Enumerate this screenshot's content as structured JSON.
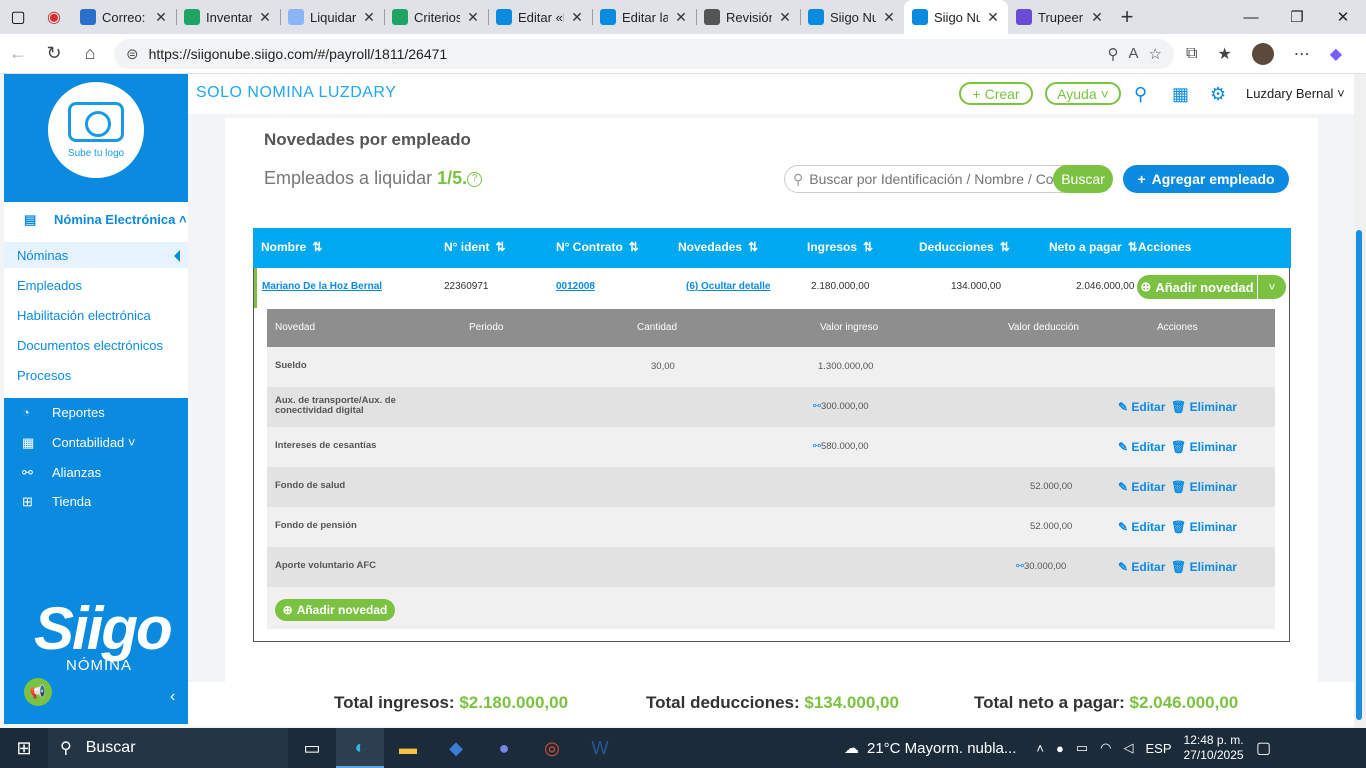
{
  "browser": {
    "tabs": [
      {
        "title": "Correo: l",
        "color": "#2a6fc9"
      },
      {
        "title": "Inventar",
        "color": "#21a366"
      },
      {
        "title": "Liquidar",
        "color": "#8ab4f8"
      },
      {
        "title": "Criterios",
        "color": "#21a366"
      },
      {
        "title": "Editar «L",
        "color": "#0b8be0"
      },
      {
        "title": "Editar la",
        "color": "#0b8be0"
      },
      {
        "title": "Revisión",
        "color": "#555555"
      },
      {
        "title": "Siigo Nu",
        "color": "#0b8be0"
      },
      {
        "title": "Siigo Nu",
        "color": "#0b8be0"
      },
      {
        "title": "Trupeer",
        "color": "#6b4bd6"
      }
    ],
    "url": "https://siigonube.siigo.com/#/payroll/1811/26471"
  },
  "sidebar": {
    "logo_label": "Sube tu logo",
    "section_title": "Nómina Electrónica",
    "items": [
      "Nóminas",
      "Empleados",
      "Habilitación electrónica",
      "Documentos electrónicos",
      "Procesos"
    ],
    "blue_items": [
      "Reportes",
      "Contabilidad",
      "Alianzas",
      "Tienda"
    ],
    "brand": "Siigo",
    "brand_sub": "NÓMINA"
  },
  "topbar": {
    "company": "SOLO NOMINA LUZDARY",
    "create": "Crear",
    "help": "Ayuda",
    "user": "Luzdary Bernal"
  },
  "page": {
    "title": "Novedades por empleado",
    "emp_label": "Empleados a liquidar",
    "emp_count": "1/5.",
    "search_placeholder": "Buscar por Identificación / Nombre / Cor",
    "search_btn": "Buscar",
    "add_emp_btn": "Agregar empleado"
  },
  "table": {
    "headers": [
      "Nombre",
      "N° ident",
      "N° Contrato",
      "Novedades",
      "Ingresos",
      "Deducciones",
      "Neto a pagar",
      "Acciones"
    ],
    "row": {
      "name": "Mariano De la Hoz Bernal",
      "ident": "22360971",
      "contract": "0012008",
      "novedades": "(6) Ocultar detalle",
      "ingresos": "2.180.000,00",
      "deducciones": "134.000,00",
      "neto": "2.046.000,00",
      "add_btn": "Añadir novedad"
    }
  },
  "detail": {
    "headers": [
      "Novedad",
      "Periodo",
      "Cantidad",
      "Valor ingreso",
      "Valor deducción",
      "Acciones"
    ],
    "rows": [
      {
        "novedad": "Sueldo",
        "cantidad": "30,00",
        "ingreso": "1.300.000,00",
        "deduccion": "",
        "link": false
      },
      {
        "novedad": "Aux. de transporte/Aux. de conectividad digital",
        "cantidad": "",
        "ingreso": "300.000,00",
        "deduccion": "",
        "link": true
      },
      {
        "novedad": "Intereses de cesantías",
        "cantidad": "",
        "ingreso": "580.000,00",
        "deduccion": "",
        "link": true
      },
      {
        "novedad": "Fondo de salud",
        "cantidad": "",
        "ingreso": "",
        "deduccion": "52.000,00",
        "link": false
      },
      {
        "novedad": "Fondo de pensión",
        "cantidad": "",
        "ingreso": "",
        "deduccion": "52.000,00",
        "link": false
      },
      {
        "novedad": "Aporte voluntario AFC",
        "cantidad": "",
        "ingreso": "",
        "deduccion": "30.000,00",
        "link": true
      }
    ],
    "edit": "Editar",
    "delete": "Eliminar",
    "add_btn": "Añadir novedad"
  },
  "totals": {
    "ingresos_label": "Total ingresos:",
    "ingresos": "$2.180.000,00",
    "deducciones_label": "Total deducciones:",
    "deducciones": "$134.000,00",
    "neto_label": "Total neto a pagar:",
    "neto": "$2.046.000,00"
  },
  "taskbar": {
    "search": "Buscar",
    "weather": "21°C  Mayorm. nubla...",
    "lang": "ESP",
    "time": "12:48 p. m.",
    "date": "27/10/2025"
  }
}
